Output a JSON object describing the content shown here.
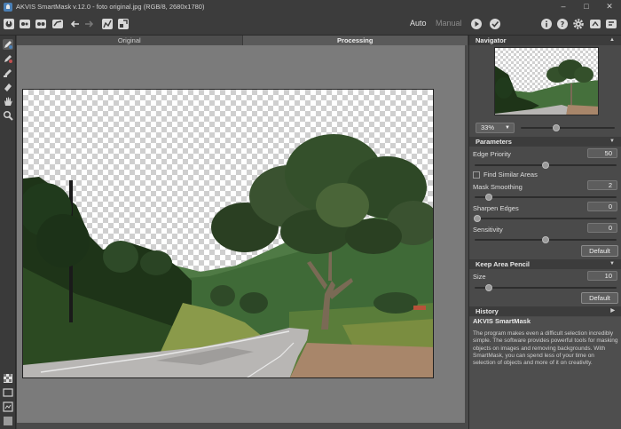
{
  "window": {
    "title": "AKVIS SmartMask v.12.0 - foto original.jpg (RGB/8, 2680x1780)",
    "controls": [
      "minimize-icon",
      "maximize-icon",
      "close-icon"
    ]
  },
  "toolbar": {
    "left_icons": [
      "home-icon",
      "open-image-icon",
      "save-image-icon",
      "batch-icon",
      "undo-icon",
      "redo-icon",
      "apply-mask-icon",
      "export-icon"
    ],
    "mode_auto": "Auto",
    "mode_manual": "Manual",
    "right_icons": [
      "info-icon",
      "help-icon",
      "settings-icon",
      "share-icon",
      "tips-icon"
    ],
    "run_icon": "play-icon",
    "apply_icon": "checkmark-icon"
  },
  "tabs": {
    "original": "Original",
    "processing": "Processing"
  },
  "tools": [
    "keep-area-pencil-icon",
    "remove-area-pencil-icon",
    "magic-brush-icon",
    "eraser-icon",
    "hand-icon",
    "zoom-icon"
  ],
  "bottom_tools": [
    "checkerboard-icon",
    "background-color-icon",
    "compare-icon",
    "fill-icon"
  ],
  "navigator": {
    "title": "Navigator",
    "zoom": "33%",
    "zoom_slider": 0.45
  },
  "parameters": {
    "title": "Parameters",
    "edge_priority": {
      "label": "Edge Priority",
      "value": "50",
      "level": 0.5
    },
    "find_similar": {
      "label": "Find Similar Areas",
      "checked": false
    },
    "mask_smoothing": {
      "label": "Mask Smoothing",
      "value": "2",
      "level": 0.1
    },
    "sharpen_edges": {
      "label": "Sharpen Edges",
      "value": "0",
      "level": 0.0
    },
    "sensitivity": {
      "label": "Sensitivity",
      "value": "0",
      "level": 0.5
    },
    "default_label": "Default"
  },
  "keep_area_pencil": {
    "title": "Keep Area Pencil",
    "size": {
      "label": "Size",
      "value": "10",
      "level": 0.1
    },
    "default_label": "Default"
  },
  "history": {
    "title": "History"
  },
  "info": {
    "title": "AKVIS SmartMask",
    "text": "The program makes even a difficult selection incredibly simple. The software provides powerful tools for masking objects on images and removing backgrounds. With SmartMask, you can spend less of your time on selection of objects and more of it on creativity."
  },
  "colors": {
    "panel_bg": "#4a4a4a",
    "header_bg": "#3c3c3c",
    "workspace_bg": "#7b7b7b",
    "accent_blue": "#4a7fb5"
  }
}
